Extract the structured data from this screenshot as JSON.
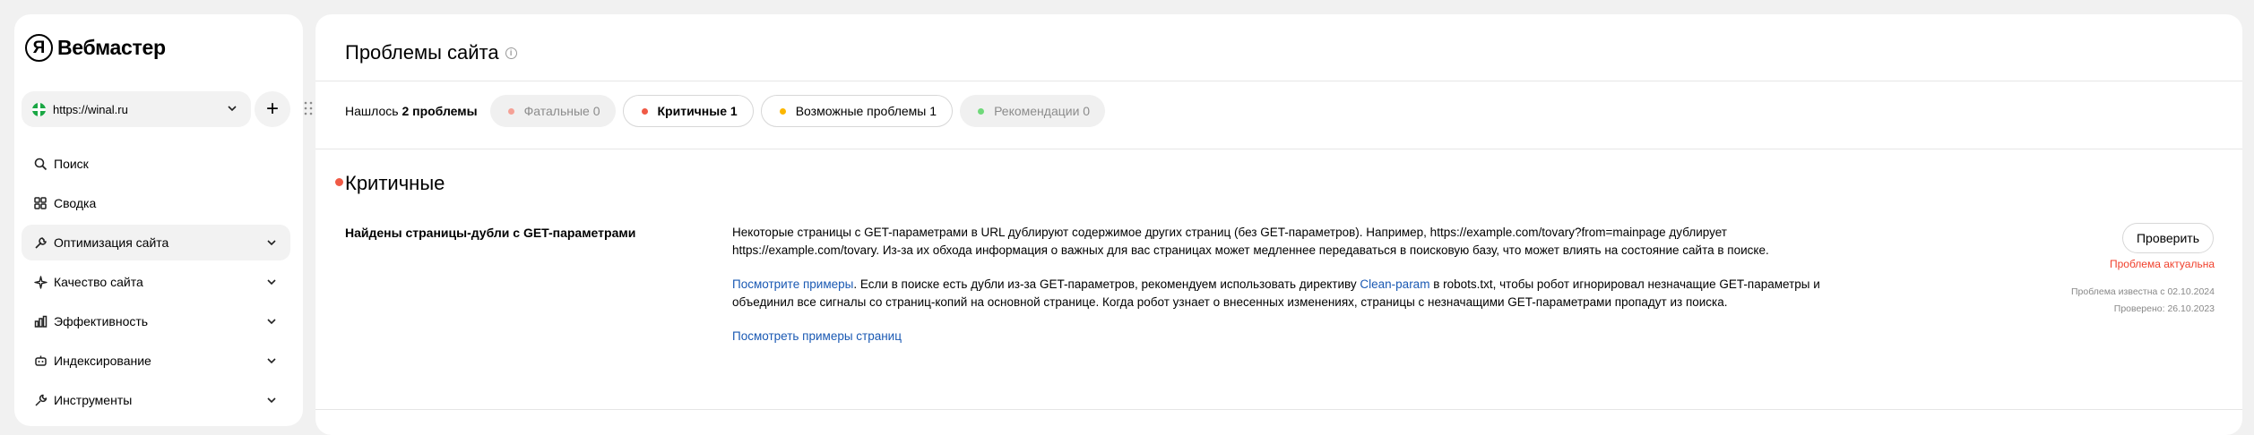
{
  "sidebar": {
    "logo_letter": "Я",
    "logo_text": "Вебмастер",
    "site": "https://winal.ru",
    "add_label": "+",
    "items": [
      {
        "label": "Поиск",
        "icon": "search-icon",
        "expandable": false,
        "active": false
      },
      {
        "label": "Сводка",
        "icon": "grid-icon",
        "expandable": false,
        "active": false
      },
      {
        "label": "Оптимизация сайта",
        "icon": "wrench-icon",
        "expandable": true,
        "active": true
      },
      {
        "label": "Качество сайта",
        "icon": "sparkle-icon",
        "expandable": true,
        "active": false
      },
      {
        "label": "Эффективность",
        "icon": "bar-chart-icon",
        "expandable": true,
        "active": false
      },
      {
        "label": "Индексирование",
        "icon": "robot-icon",
        "expandable": true,
        "active": false
      },
      {
        "label": "Инструменты",
        "icon": "tool-icon",
        "expandable": true,
        "active": false
      }
    ]
  },
  "main": {
    "title": "Проблемы сайта",
    "info_icon": "i",
    "found_prefix": "Нашлось",
    "found_count": "2 проблемы",
    "filters": [
      {
        "label": "Фатальные",
        "count": "0",
        "color": "#f5a196",
        "style": "muted"
      },
      {
        "label": "Критичные",
        "count": "1",
        "color": "#f05a46",
        "style": "outlined",
        "selected": true
      },
      {
        "label": "Возможные проблемы",
        "count": "1",
        "color": "#fcb700",
        "style": "outlined"
      },
      {
        "label": "Рекомендации",
        "count": "0",
        "color": "#6fd97a",
        "style": "muted"
      }
    ],
    "section": {
      "title": "Критичные",
      "dot_color": "#f05a46"
    },
    "problem": {
      "title": "Найдены страницы-дубли с GET-параметрами",
      "para1": "Некоторые страницы с GET-параметрами в URL дублируют содержимое других страниц (без GET-параметров). Например, https://example.com/tovary?from=mainpage дублирует https://example.com/tovary. Из-за их обхода информация о важных для вас страницах может медленнее передаваться в поисковую базу, что может влиять на состояние сайта в поиске.",
      "para2_link1": "Посмотрите примеры",
      "para2_text1": ". Если в поиске есть дубли из-за GET-параметров, рекомендуем использовать директиву ",
      "para2_link2": "Clean-param",
      "para2_text2": " в robots.txt, чтобы робот игнорировал незначащие GET-параметры и объединил все сигналы со страниц-копий на основной странице. Когда робот узнает о внесенных изменениях, страницы с незначащими GET-параметрами пропадут из поиска.",
      "examples_link": "Посмотреть примеры страниц",
      "check_button": "Проверить",
      "status": "Проблема актуальна",
      "known_since": "Проблема известна с 02.10.2024",
      "checked": "Проверено: 26.10.2023"
    }
  }
}
